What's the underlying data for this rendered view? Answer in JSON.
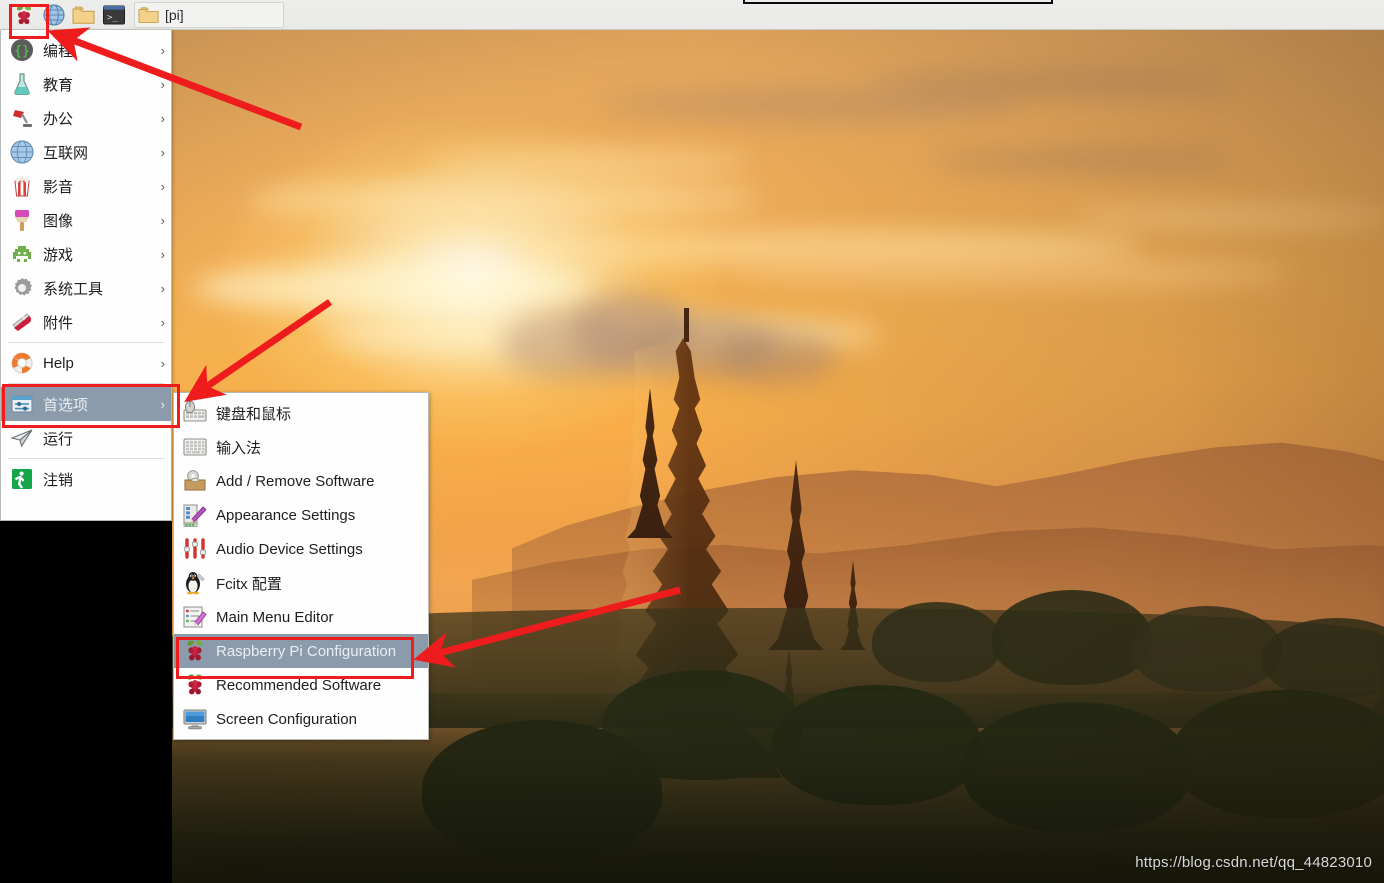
{
  "taskbar": {
    "buttons": [
      {
        "name": "raspberry-menu",
        "icon": "raspberry-icon",
        "label": ""
      },
      {
        "name": "web-browser",
        "icon": "globe-icon",
        "label": ""
      },
      {
        "name": "file-manager",
        "icon": "folder-icon",
        "label": ""
      },
      {
        "name": "terminal",
        "icon": "terminal-icon",
        "label": ""
      }
    ],
    "window_button": {
      "label": "[pi]",
      "icon": "folder-icon"
    }
  },
  "main_menu": {
    "items": [
      {
        "label": "编程",
        "icon": "code-braces-icon",
        "arrow": "›",
        "selected": false,
        "separator_after": false
      },
      {
        "label": "教育",
        "icon": "flask-icon",
        "arrow": "›",
        "selected": false,
        "separator_after": false
      },
      {
        "label": "办公",
        "icon": "desk-lamp-icon",
        "arrow": "›",
        "selected": false,
        "separator_after": false
      },
      {
        "label": "互联网",
        "icon": "globe-icon",
        "arrow": "›",
        "selected": false,
        "separator_after": false
      },
      {
        "label": "影音",
        "icon": "popcorn-icon",
        "arrow": "›",
        "selected": false,
        "separator_after": false
      },
      {
        "label": "图像",
        "icon": "paintbrush-icon",
        "arrow": "›",
        "selected": false,
        "separator_after": false
      },
      {
        "label": "游戏",
        "icon": "space-invader-icon",
        "arrow": "›",
        "selected": false,
        "separator_after": false
      },
      {
        "label": "系统工具",
        "icon": "gear-icon",
        "arrow": "›",
        "selected": false,
        "separator_after": false
      },
      {
        "label": "附件",
        "icon": "swiss-knife-icon",
        "arrow": "›",
        "selected": false,
        "separator_after": true
      },
      {
        "label": "Help",
        "icon": "lifebuoy-icon",
        "arrow": "›",
        "selected": false,
        "separator_after": true
      },
      {
        "label": "首选项",
        "icon": "preferences-sliders-icon",
        "arrow": "›",
        "selected": true,
        "separator_after": false
      },
      {
        "label": "运行",
        "icon": "paper-plane-icon",
        "arrow": "",
        "selected": false,
        "separator_after": true
      },
      {
        "label": "注销",
        "icon": "logout-person-icon",
        "arrow": "",
        "selected": false,
        "separator_after": false
      }
    ]
  },
  "submenu": {
    "parent": "首选项",
    "items": [
      {
        "label": "键盘和鼠标",
        "icon": "keyboard-mouse-icon",
        "selected": false
      },
      {
        "label": "输入法",
        "icon": "input-method-icon",
        "selected": false
      },
      {
        "label": "Add / Remove Software",
        "icon": "software-box-icon",
        "selected": false
      },
      {
        "label": "Appearance Settings",
        "icon": "appearance-palette-icon",
        "selected": false
      },
      {
        "label": "Audio Device Settings",
        "icon": "audio-sliders-icon",
        "selected": false
      },
      {
        "label": "Fcitx 配置",
        "icon": "tux-penguin-icon",
        "selected": false
      },
      {
        "label": "Main Menu Editor",
        "icon": "menu-editor-pencil-icon",
        "selected": false
      },
      {
        "label": "Raspberry Pi Configuration",
        "icon": "raspberry-icon",
        "selected": true
      },
      {
        "label": "Recommended Software",
        "icon": "raspberry-icon",
        "selected": false
      },
      {
        "label": "Screen Configuration",
        "icon": "monitor-icon",
        "selected": false
      }
    ]
  },
  "annotations": {
    "color": "#ee1c1c",
    "boxes": [
      {
        "name": "annot-box-raspberry-button",
        "target": "raspberry-menu-button"
      },
      {
        "name": "annot-box-preferences-item",
        "target": "首选项"
      },
      {
        "name": "annot-box-rpi-config-item",
        "target": "Raspberry Pi Configuration"
      }
    ],
    "arrows": [
      {
        "name": "annot-arrow-to-raspberry-button",
        "points_to": "raspberry-menu-button"
      },
      {
        "name": "annot-arrow-to-preferences",
        "points_to": "首选项"
      },
      {
        "name": "annot-arrow-to-rpi-config",
        "points_to": "Raspberry Pi Configuration"
      }
    ]
  },
  "watermark": {
    "text": "https://blog.csdn.net/qq_44823010"
  },
  "wallpaper": {
    "name": "bagan-sunset-temples",
    "colors": {
      "sky_top": "#d9a05b",
      "sky_mid": "#f6b14f",
      "sun_glow": "#fffbe0",
      "silhouette": "#4a2a11",
      "foreground": "#1f2a12"
    }
  }
}
